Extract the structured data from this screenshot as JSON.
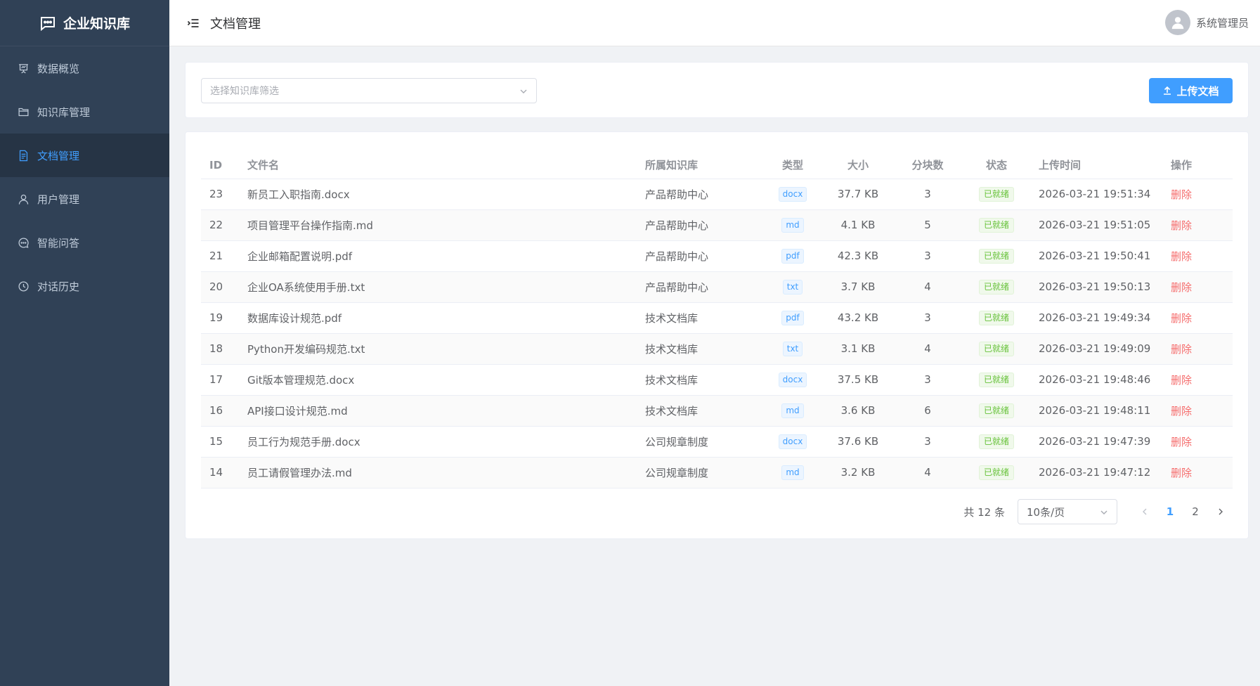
{
  "sidebar": {
    "brand": "企业知识库",
    "items": [
      {
        "label": "数据概览",
        "icon": "chart-board-icon"
      },
      {
        "label": "知识库管理",
        "icon": "folder-icon"
      },
      {
        "label": "文档管理",
        "icon": "document-icon",
        "active": true
      },
      {
        "label": "用户管理",
        "icon": "user-icon"
      },
      {
        "label": "智能问答",
        "icon": "chat-icon"
      },
      {
        "label": "对话历史",
        "icon": "clock-icon"
      }
    ]
  },
  "header": {
    "title": "文档管理",
    "user": "系统管理员"
  },
  "filter": {
    "placeholder": "选择知识库筛选",
    "upload_label": "上传文档"
  },
  "table": {
    "columns": [
      "ID",
      "文件名",
      "所属知识库",
      "类型",
      "大小",
      "分块数",
      "状态",
      "上传时间",
      "操作"
    ],
    "rows": [
      {
        "id": "23",
        "name": "新员工入职指南.docx",
        "kb": "产品帮助中心",
        "type": "docx",
        "size": "37.7 KB",
        "chunks": "3",
        "status": "已就绪",
        "time": "2026-03-21 19:51:34",
        "op": "删除"
      },
      {
        "id": "22",
        "name": "项目管理平台操作指南.md",
        "kb": "产品帮助中心",
        "type": "md",
        "size": "4.1 KB",
        "chunks": "5",
        "status": "已就绪",
        "time": "2026-03-21 19:51:05",
        "op": "删除"
      },
      {
        "id": "21",
        "name": "企业邮箱配置说明.pdf",
        "kb": "产品帮助中心",
        "type": "pdf",
        "size": "42.3 KB",
        "chunks": "3",
        "status": "已就绪",
        "time": "2026-03-21 19:50:41",
        "op": "删除"
      },
      {
        "id": "20",
        "name": "企业OA系统使用手册.txt",
        "kb": "产品帮助中心",
        "type": "txt",
        "size": "3.7 KB",
        "chunks": "4",
        "status": "已就绪",
        "time": "2026-03-21 19:50:13",
        "op": "删除"
      },
      {
        "id": "19",
        "name": "数据库设计规范.pdf",
        "kb": "技术文档库",
        "type": "pdf",
        "size": "43.2 KB",
        "chunks": "3",
        "status": "已就绪",
        "time": "2026-03-21 19:49:34",
        "op": "删除"
      },
      {
        "id": "18",
        "name": "Python开发编码规范.txt",
        "kb": "技术文档库",
        "type": "txt",
        "size": "3.1 KB",
        "chunks": "4",
        "status": "已就绪",
        "time": "2026-03-21 19:49:09",
        "op": "删除"
      },
      {
        "id": "17",
        "name": "Git版本管理规范.docx",
        "kb": "技术文档库",
        "type": "docx",
        "size": "37.5 KB",
        "chunks": "3",
        "status": "已就绪",
        "time": "2026-03-21 19:48:46",
        "op": "删除"
      },
      {
        "id": "16",
        "name": "API接口设计规范.md",
        "kb": "技术文档库",
        "type": "md",
        "size": "3.6 KB",
        "chunks": "6",
        "status": "已就绪",
        "time": "2026-03-21 19:48:11",
        "op": "删除"
      },
      {
        "id": "15",
        "name": "员工行为规范手册.docx",
        "kb": "公司规章制度",
        "type": "docx",
        "size": "37.6 KB",
        "chunks": "3",
        "status": "已就绪",
        "time": "2026-03-21 19:47:39",
        "op": "删除"
      },
      {
        "id": "14",
        "name": "员工请假管理办法.md",
        "kb": "公司规章制度",
        "type": "md",
        "size": "3.2 KB",
        "chunks": "4",
        "status": "已就绪",
        "time": "2026-03-21 19:47:12",
        "op": "删除"
      }
    ]
  },
  "pagination": {
    "total": "共 12 条",
    "page_size": "10条/页",
    "pages": [
      "1",
      "2"
    ],
    "current": "1"
  },
  "colors": {
    "sidebar_bg": "#304156",
    "accent": "#409eff",
    "success": "#67c23a",
    "danger": "#f56c6c"
  }
}
